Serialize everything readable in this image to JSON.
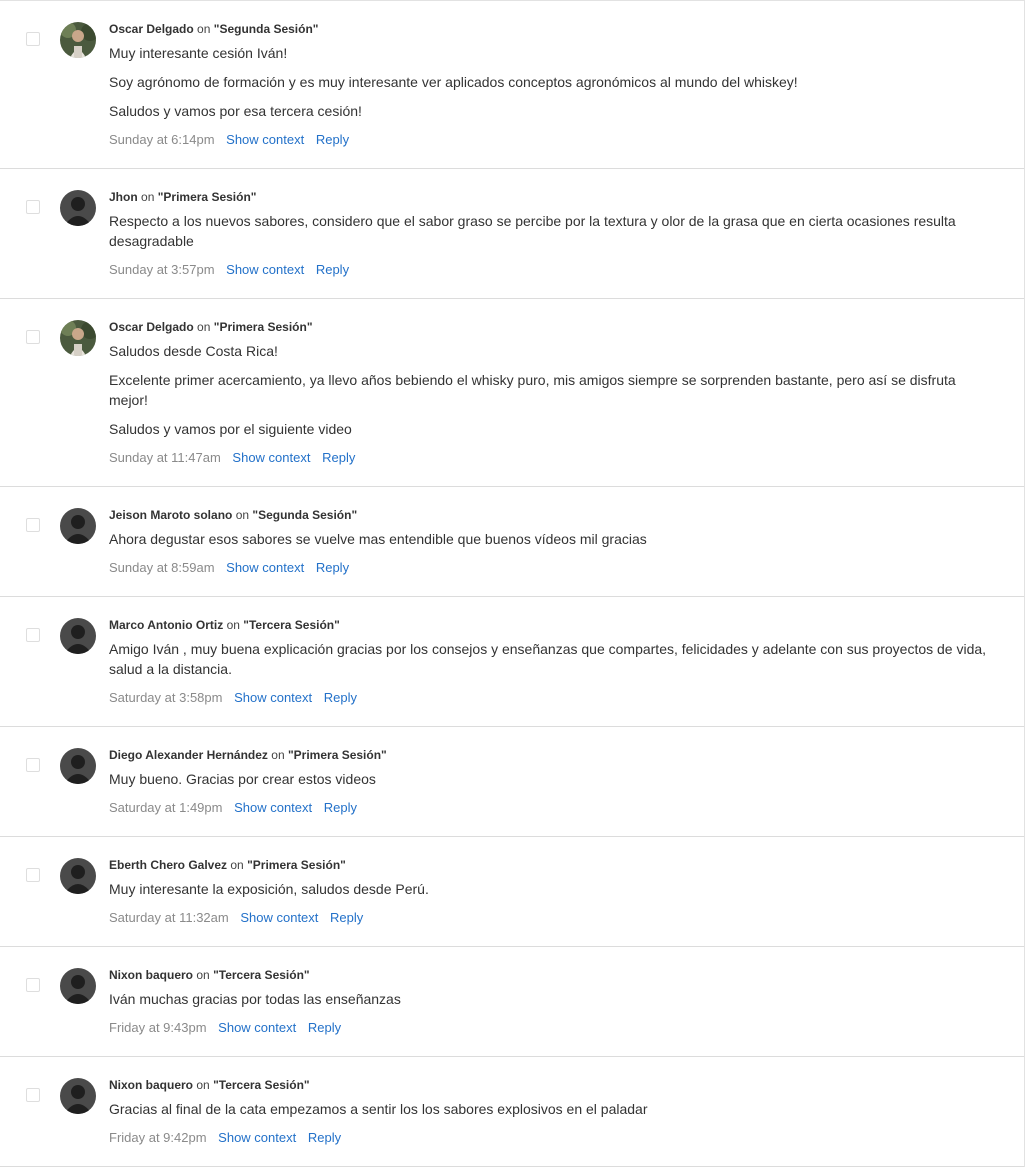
{
  "connector_word": "on",
  "actions": {
    "show_context": "Show context",
    "reply": "Reply"
  },
  "colors": {
    "link": "#2371c9",
    "timestamp": "#8a8a8a",
    "divider": "#dcdcdc"
  },
  "comments": [
    {
      "author": "Oscar Delgado",
      "post": "\"Segunda Sesión\"",
      "avatar": "photo-avatar",
      "paragraphs": [
        "Muy interesante cesión Iván!",
        "Soy agrónomo de formación y es muy interesante ver aplicados conceptos agronómicos al mundo del whiskey!",
        "Saludos y vamos por esa tercera cesión!"
      ],
      "time": "Sunday at 6:14pm"
    },
    {
      "author": "Jhon",
      "post": "\"Primera Sesión\"",
      "avatar": "default-avatar",
      "paragraphs": [
        "Respecto a los nuevos sabores, considero que el sabor graso se percibe por la textura y olor de la grasa que en cierta ocasiones resulta desagradable"
      ],
      "time": "Sunday at 3:57pm"
    },
    {
      "author": "Oscar Delgado",
      "post": "\"Primera Sesión\"",
      "avatar": "photo-avatar",
      "paragraphs": [
        "Saludos desde Costa Rica!",
        "Excelente primer acercamiento, ya llevo años bebiendo el whisky puro, mis amigos siempre se sorprenden bastante, pero así se disfruta mejor!",
        "Saludos y vamos por el siguiente video"
      ],
      "time": "Sunday at 11:47am"
    },
    {
      "author": "Jeison Maroto solano",
      "post": "\"Segunda Sesión\"",
      "avatar": "default-avatar",
      "paragraphs": [
        "Ahora degustar esos sabores se vuelve mas entendible que buenos vídeos mil gracias"
      ],
      "time": "Sunday at 8:59am"
    },
    {
      "author": "Marco Antonio Ortiz",
      "post": "\"Tercera Sesión\"",
      "avatar": "default-avatar",
      "paragraphs": [
        "Amigo Iván , muy buena explicación gracias por los consejos y enseñanzas que compartes, felicidades y adelante con sus proyectos de vida, salud a la distancia."
      ],
      "time": "Saturday at 3:58pm"
    },
    {
      "author": "Diego Alexander Hernández",
      "post": "\"Primera Sesión\"",
      "avatar": "default-avatar",
      "paragraphs": [
        "Muy bueno. Gracias por crear estos videos"
      ],
      "time": "Saturday at 1:49pm"
    },
    {
      "author": "Eberth Chero Galvez",
      "post": "\"Primera Sesión\"",
      "avatar": "default-avatar",
      "paragraphs": [
        "Muy interesante la exposición, saludos desde Perú."
      ],
      "time": "Saturday at 11:32am"
    },
    {
      "author": "Nixon baquero",
      "post": "\"Tercera Sesión\"",
      "avatar": "default-avatar",
      "paragraphs": [
        "Iván muchas gracias por todas las enseñanzas"
      ],
      "time": "Friday at 9:43pm"
    },
    {
      "author": "Nixon baquero",
      "post": "\"Tercera Sesión\"",
      "avatar": "default-avatar",
      "paragraphs": [
        "Gracias al final de la cata empezamos a sentir los los sabores explosivos en el paladar"
      ],
      "time": "Friday at 9:42pm"
    }
  ]
}
